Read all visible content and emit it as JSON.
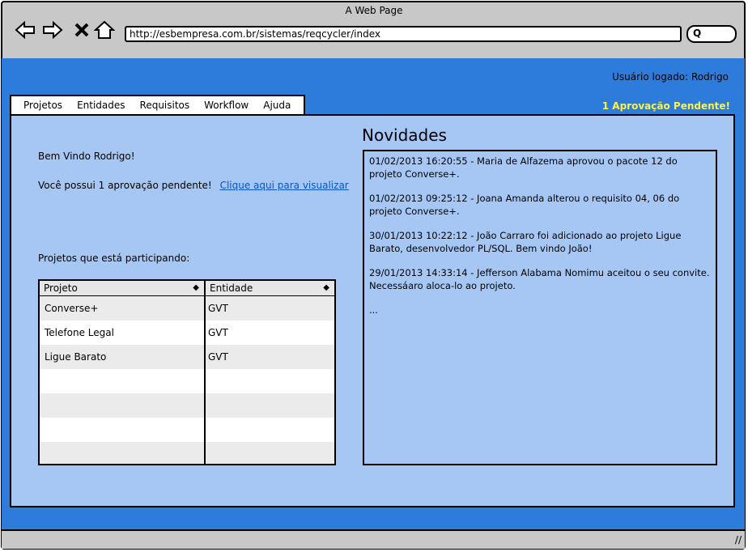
{
  "browser": {
    "title": "A Web Page",
    "url": "http://esbempresa.com.br/sistemas/reqcycler/index",
    "search_icon": "Q"
  },
  "header": {
    "user_logged": "Usuário logado: Rodrigo",
    "pending_alert": "1 Aprovação Pendente!"
  },
  "menu": [
    "Projetos",
    "Entidades",
    "Requisitos",
    "Workflow",
    "Ajuda"
  ],
  "main": {
    "welcome": "Bem Vindo Rodrigo!",
    "pending_text": "Você possui 1 aprovação pendente!",
    "pending_link": "Clique aqui para visualizar",
    "projects_label": "Projetos que está participando:",
    "table": {
      "columns": [
        "Projeto",
        "Entidade"
      ],
      "rows": [
        [
          "Converse+",
          "GVT"
        ],
        [
          "Telefone Legal",
          "GVT"
        ],
        [
          "Ligue Barato",
          "GVT"
        ],
        [
          "",
          ""
        ],
        [
          "",
          ""
        ],
        [
          "",
          ""
        ],
        [
          "",
          ""
        ]
      ]
    }
  },
  "news": {
    "title": "Novidades",
    "items": [
      "01/02/2013 16:20:55 -  Maria de Alfazema aprovou o pacote 12 do projeto Converse+.",
      "01/02/2013 09:25:12 -  Joana Amanda alterou o requisito 04, 06 do projeto Converse+.",
      "30/01/2013 10:22:12 -  João Carraro foi adicionado ao projeto Ligue Barato, desenvolvedor PL/SQL. Bem vindo João!",
      "29/01/2013 14:33:14 -  Jefferson Alabama Nomimu aceitou o seu convite. Necessáaro aloca-lo ao  projeto.",
      "..."
    ]
  },
  "colors": {
    "accent": "#2d7cdc",
    "panel": "#a6c7f4",
    "alert": "#fff33b",
    "link": "#0b55c3"
  }
}
